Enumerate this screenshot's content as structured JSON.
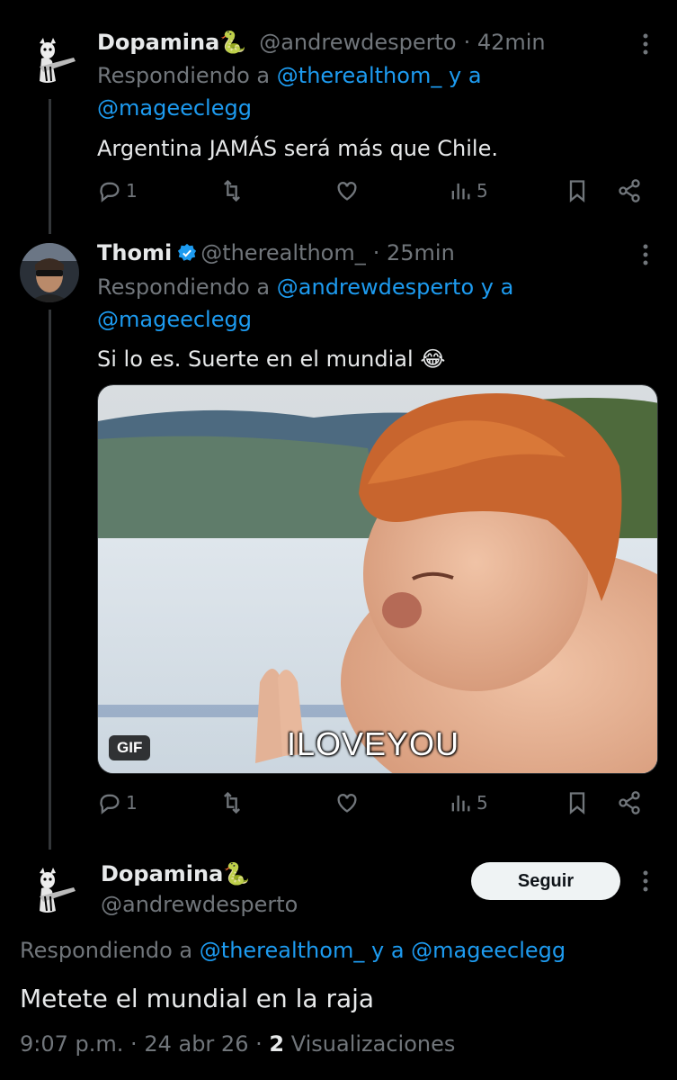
{
  "tweets": [
    {
      "name": "Dopamina",
      "name_emoji": "🐍",
      "handle": "@andrewdesperto",
      "time": "· 42min",
      "reply_prefix": "Respondiendo a",
      "reply_user1": "@therealthom_",
      "reply_and": "y a",
      "reply_user2": "@mageeclegg",
      "text": "Argentina JAMÁS será más que Chile.",
      "replies": "1",
      "views": "5"
    },
    {
      "name": "Thomi",
      "handle": "@therealthom_",
      "time": "· 25min",
      "reply_prefix": "Respondiendo a",
      "reply_user1": "@andrewdesperto",
      "reply_and": "y a",
      "reply_user2": "@mageeclegg",
      "text": "Si lo es. Suerte en el mundial",
      "text_emoji": "😂",
      "media_badge": "GIF",
      "media_caption": "ILOVEYOU",
      "replies": "1",
      "views": "5"
    }
  ],
  "main_tweet": {
    "name": "Dopamina",
    "name_emoji": "🐍",
    "handle": "@andrewdesperto",
    "follow_label": "Seguir",
    "reply_prefix": "Respondiendo a",
    "reply_user1": "@therealthom_",
    "reply_and": "y a",
    "reply_user2": "@mageeclegg",
    "text": "Metete el mundial en la raja",
    "time": "9:07 p.m.",
    "date": "24 abr 26",
    "views_count": "2",
    "views_label": "Visualizaciones"
  },
  "colors": {
    "background": "#000000",
    "accent_blue": "#1d9bf0",
    "muted_text": "#71767b",
    "primary_text": "#e7e9ea"
  },
  "icons": [
    "reply-icon",
    "retweet-icon",
    "like-icon",
    "views-icon",
    "bookmark-icon",
    "share-icon",
    "more-icon",
    "verified-icon"
  ]
}
